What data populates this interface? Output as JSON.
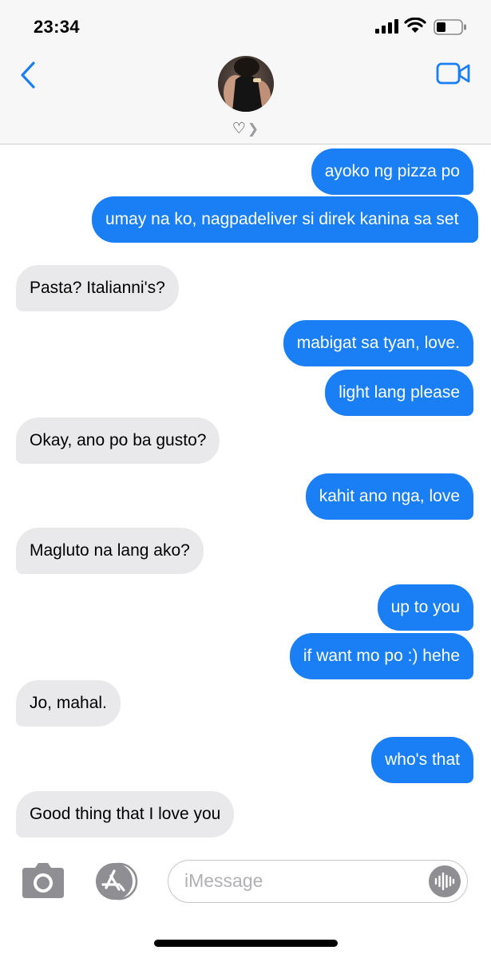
{
  "status_bar": {
    "time": "23:34",
    "icons": [
      "signal-icon",
      "wifi-icon",
      "battery-icon"
    ]
  },
  "header": {
    "contact_name": "♡",
    "icons": [
      "back-chevron-icon",
      "video-call-icon"
    ],
    "accent_color": "#1a7ff5"
  },
  "messages": [
    {
      "direction": "sent",
      "text": "ayoko ng pizza po"
    },
    {
      "direction": "sent",
      "text": "umay na ko, nagpadeliver si direk kanina sa set"
    },
    {
      "direction": "received",
      "text": "Pasta? Italianni's?"
    },
    {
      "direction": "sent",
      "text": "mabigat sa tyan, love."
    },
    {
      "direction": "sent",
      "text": "light lang please"
    },
    {
      "direction": "received",
      "text": "Okay, ano po ba gusto?"
    },
    {
      "direction": "sent",
      "text": "kahit ano nga, love"
    },
    {
      "direction": "received",
      "text": "Magluto na lang ako?"
    },
    {
      "direction": "sent",
      "text": "up to you"
    },
    {
      "direction": "sent",
      "text": "if want mo po :) hehe"
    },
    {
      "direction": "received",
      "text": "Jo, mahal."
    },
    {
      "direction": "sent",
      "text": "who's that"
    },
    {
      "direction": "received",
      "text": "Good thing that I love you"
    },
    {
      "direction": "sent",
      "text": ""
    }
  ],
  "colors": {
    "sent_bubble": "#1a7ff5",
    "received_bubble": "#e9e9eb"
  },
  "input_bar": {
    "placeholder": "iMessage",
    "value": "",
    "icons": [
      "camera-icon",
      "app-store-icon",
      "audio-waveform-icon"
    ]
  }
}
